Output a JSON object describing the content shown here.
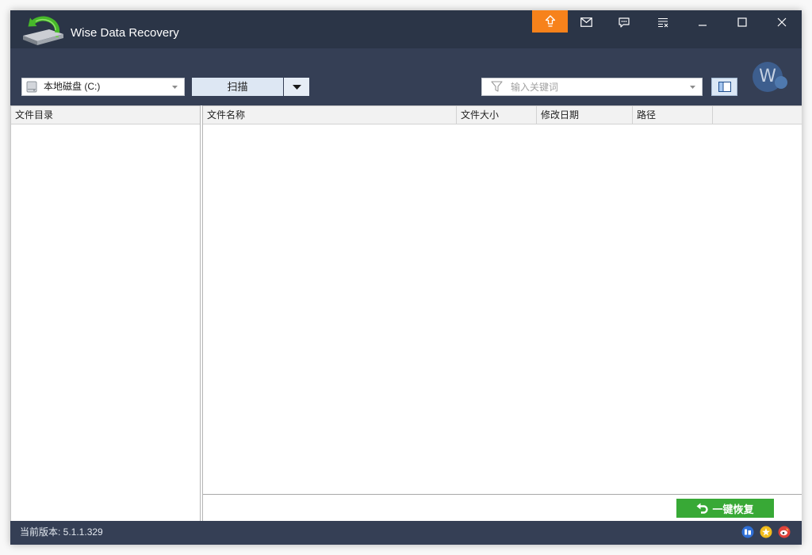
{
  "window": {
    "title": "Wise Data Recovery"
  },
  "titlebar": {
    "buttons": [
      {
        "icon": "upgrade-icon"
      },
      {
        "icon": "mail-icon"
      },
      {
        "icon": "feedback-icon"
      },
      {
        "icon": "menu-icon"
      },
      {
        "icon": "minimize-icon"
      },
      {
        "icon": "maximize-icon"
      },
      {
        "icon": "close-icon"
      }
    ]
  },
  "toolbar": {
    "drive": {
      "value": "本地磁盘 (C:)",
      "icon": "drive-icon"
    },
    "scan": {
      "label": "扫描"
    },
    "search": {
      "placeholder": "输入关键词",
      "icon": "filter-icon"
    },
    "view_toggle": {
      "icon": "panel-layout-icon"
    },
    "avatar": {
      "letter": "W"
    }
  },
  "folder_tree": {
    "header": "文件目录"
  },
  "file_list": {
    "columns": [
      {
        "label": "文件名称"
      },
      {
        "label": "文件大小"
      },
      {
        "label": "修改日期"
      },
      {
        "label": "路径"
      }
    ]
  },
  "recover": {
    "label": "一键恢复",
    "icon": "undo-icon"
  },
  "statusbar": {
    "version": "当前版本: 5.1.1.329",
    "social": [
      {
        "icon": "tieba-icon"
      },
      {
        "icon": "qzone-icon"
      },
      {
        "icon": "weibo-icon"
      }
    ]
  },
  "colors": {
    "titlebar": "#2b3547",
    "toolbar": "#353f55",
    "accent_orange": "#f7821b",
    "recover_green": "#38a936",
    "avatar_blue": "#3d5e8e"
  }
}
